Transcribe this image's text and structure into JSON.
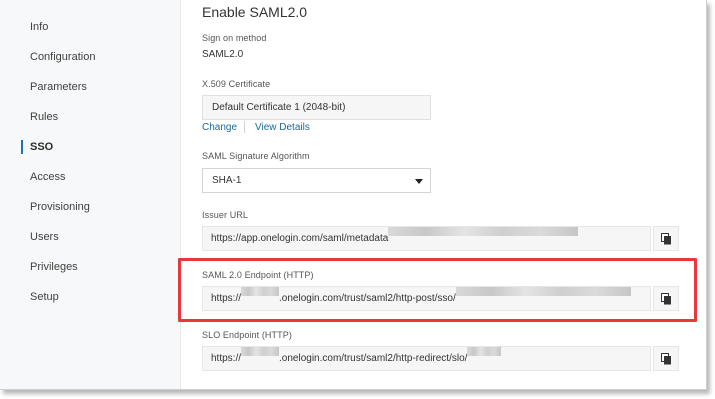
{
  "sidebar": {
    "items": [
      {
        "label": "Info"
      },
      {
        "label": "Configuration"
      },
      {
        "label": "Parameters"
      },
      {
        "label": "Rules"
      },
      {
        "label": "SSO",
        "active": true
      },
      {
        "label": "Access"
      },
      {
        "label": "Provisioning"
      },
      {
        "label": "Users"
      },
      {
        "label": "Privileges"
      },
      {
        "label": "Setup"
      }
    ],
    "active_color": "#1a73b5"
  },
  "main": {
    "title": "Enable SAML2.0",
    "sign_on": {
      "label": "Sign on method",
      "value": "SAML2.0"
    },
    "certificate": {
      "label": "X.509 Certificate",
      "value": "Default Certificate 1 (2048-bit)",
      "change_link": "Change",
      "view_link": "View Details"
    },
    "algorithm": {
      "label": "SAML Signature Algorithm",
      "value": "SHA-1"
    },
    "issuer": {
      "label": "Issuer URL",
      "prefix": "https://app.onelogin.com/saml/metadata",
      "suffix": "",
      "redacted": true
    },
    "saml_endpoint": {
      "label": "SAML 2.0 Endpoint (HTTP)",
      "prefix": "https://",
      "middle": ".onelogin.com/trust/saml2/http-post/sso/",
      "redacted": true
    },
    "slo_endpoint": {
      "label": "SLO Endpoint (HTTP)",
      "prefix": "https://",
      "middle": ".onelogin.com/trust/saml2/http-redirect/slo/",
      "redacted": true
    },
    "copy_icon": "copy-icon",
    "highlight_color": "#e8383d",
    "link_color": "#1a6a9a"
  }
}
